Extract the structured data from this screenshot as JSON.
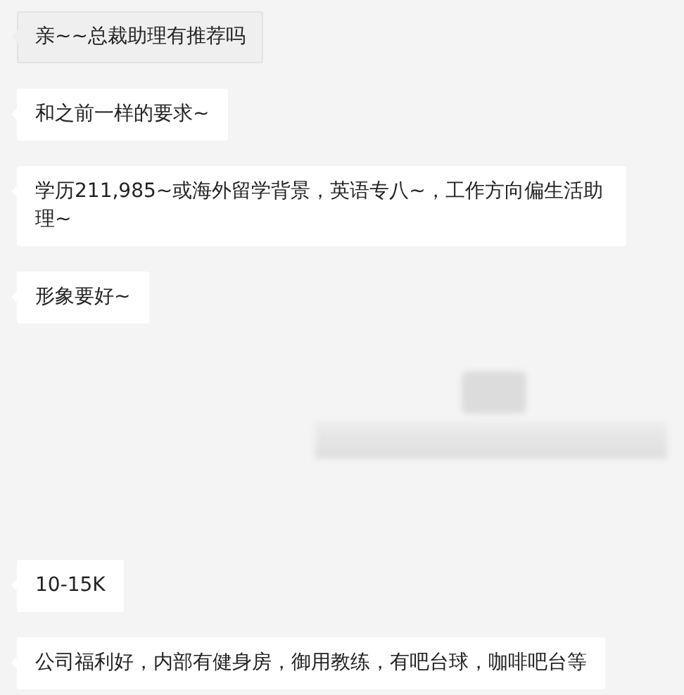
{
  "messages": [
    {
      "kind": "text",
      "text": "亲~~总裁助理有推荐吗",
      "highlighted": true
    },
    {
      "kind": "text",
      "text": "和之前一样的要求~",
      "highlighted": false
    },
    {
      "kind": "text",
      "text": "学历211,985~或海外留学背景，英语专八~，工作方向偏生活助理~",
      "highlighted": false
    },
    {
      "kind": "text",
      "text": "形象要好~",
      "highlighted": false
    },
    {
      "kind": "blurred"
    },
    {
      "kind": "text",
      "text": "10-15K",
      "highlighted": false
    },
    {
      "kind": "text",
      "text": "公司福利好，内部有健身房，御用教练，有吧台球，咖啡吧台等",
      "highlighted": false
    }
  ]
}
